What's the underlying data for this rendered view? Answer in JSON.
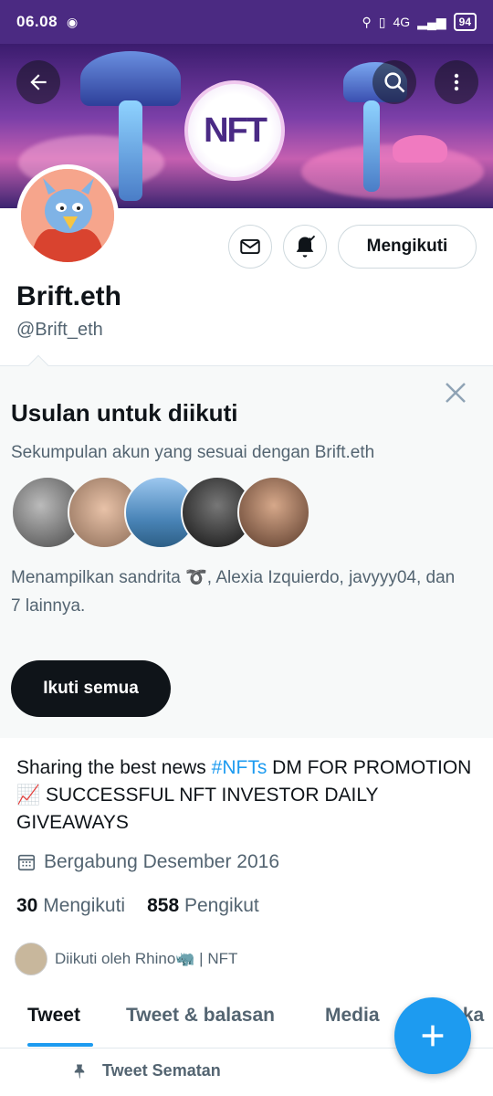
{
  "status_bar": {
    "time": "06.08",
    "battery": "94",
    "network": "4G"
  },
  "banner": {
    "logo_text": "NFT"
  },
  "profile": {
    "name": "Brift.eth",
    "handle": "@Brift_eth",
    "follow_label": "Mengikuti"
  },
  "suggestions": {
    "title": "Usulan untuk diikuti",
    "subtitle": "Sekumpulan akun yang sesuai dengan Brift.eth",
    "description": "Menampilkan sandrita ➰, Alexia Izquierdo, javyyy04, dan 7 lainnya.",
    "follow_all_label": "Ikuti semua"
  },
  "bio": {
    "text_before": "Sharing the best news ",
    "hashtag": "#NFTs",
    "text_after": " DM FOR PROMOTION 📈 SUCCESSFUL NFT INVESTOR DAILY GIVEAWAYS"
  },
  "joined": "Bergabung Desember 2016",
  "counts": {
    "following_number": "30",
    "following_label": "Mengikuti",
    "followers_number": "858",
    "followers_label": "Pengikut"
  },
  "followed_by": "Diikuti oleh Rhino🦏 | NFT",
  "tabs": [
    "Tweet",
    "Tweet & balasan",
    "Media",
    "Suka"
  ],
  "pinned_label": "Tweet Sematan",
  "colors": {
    "accent": "#1d9bf0",
    "status_bar": "#4b2a82",
    "text": "#0f1419",
    "muted": "#536471"
  }
}
